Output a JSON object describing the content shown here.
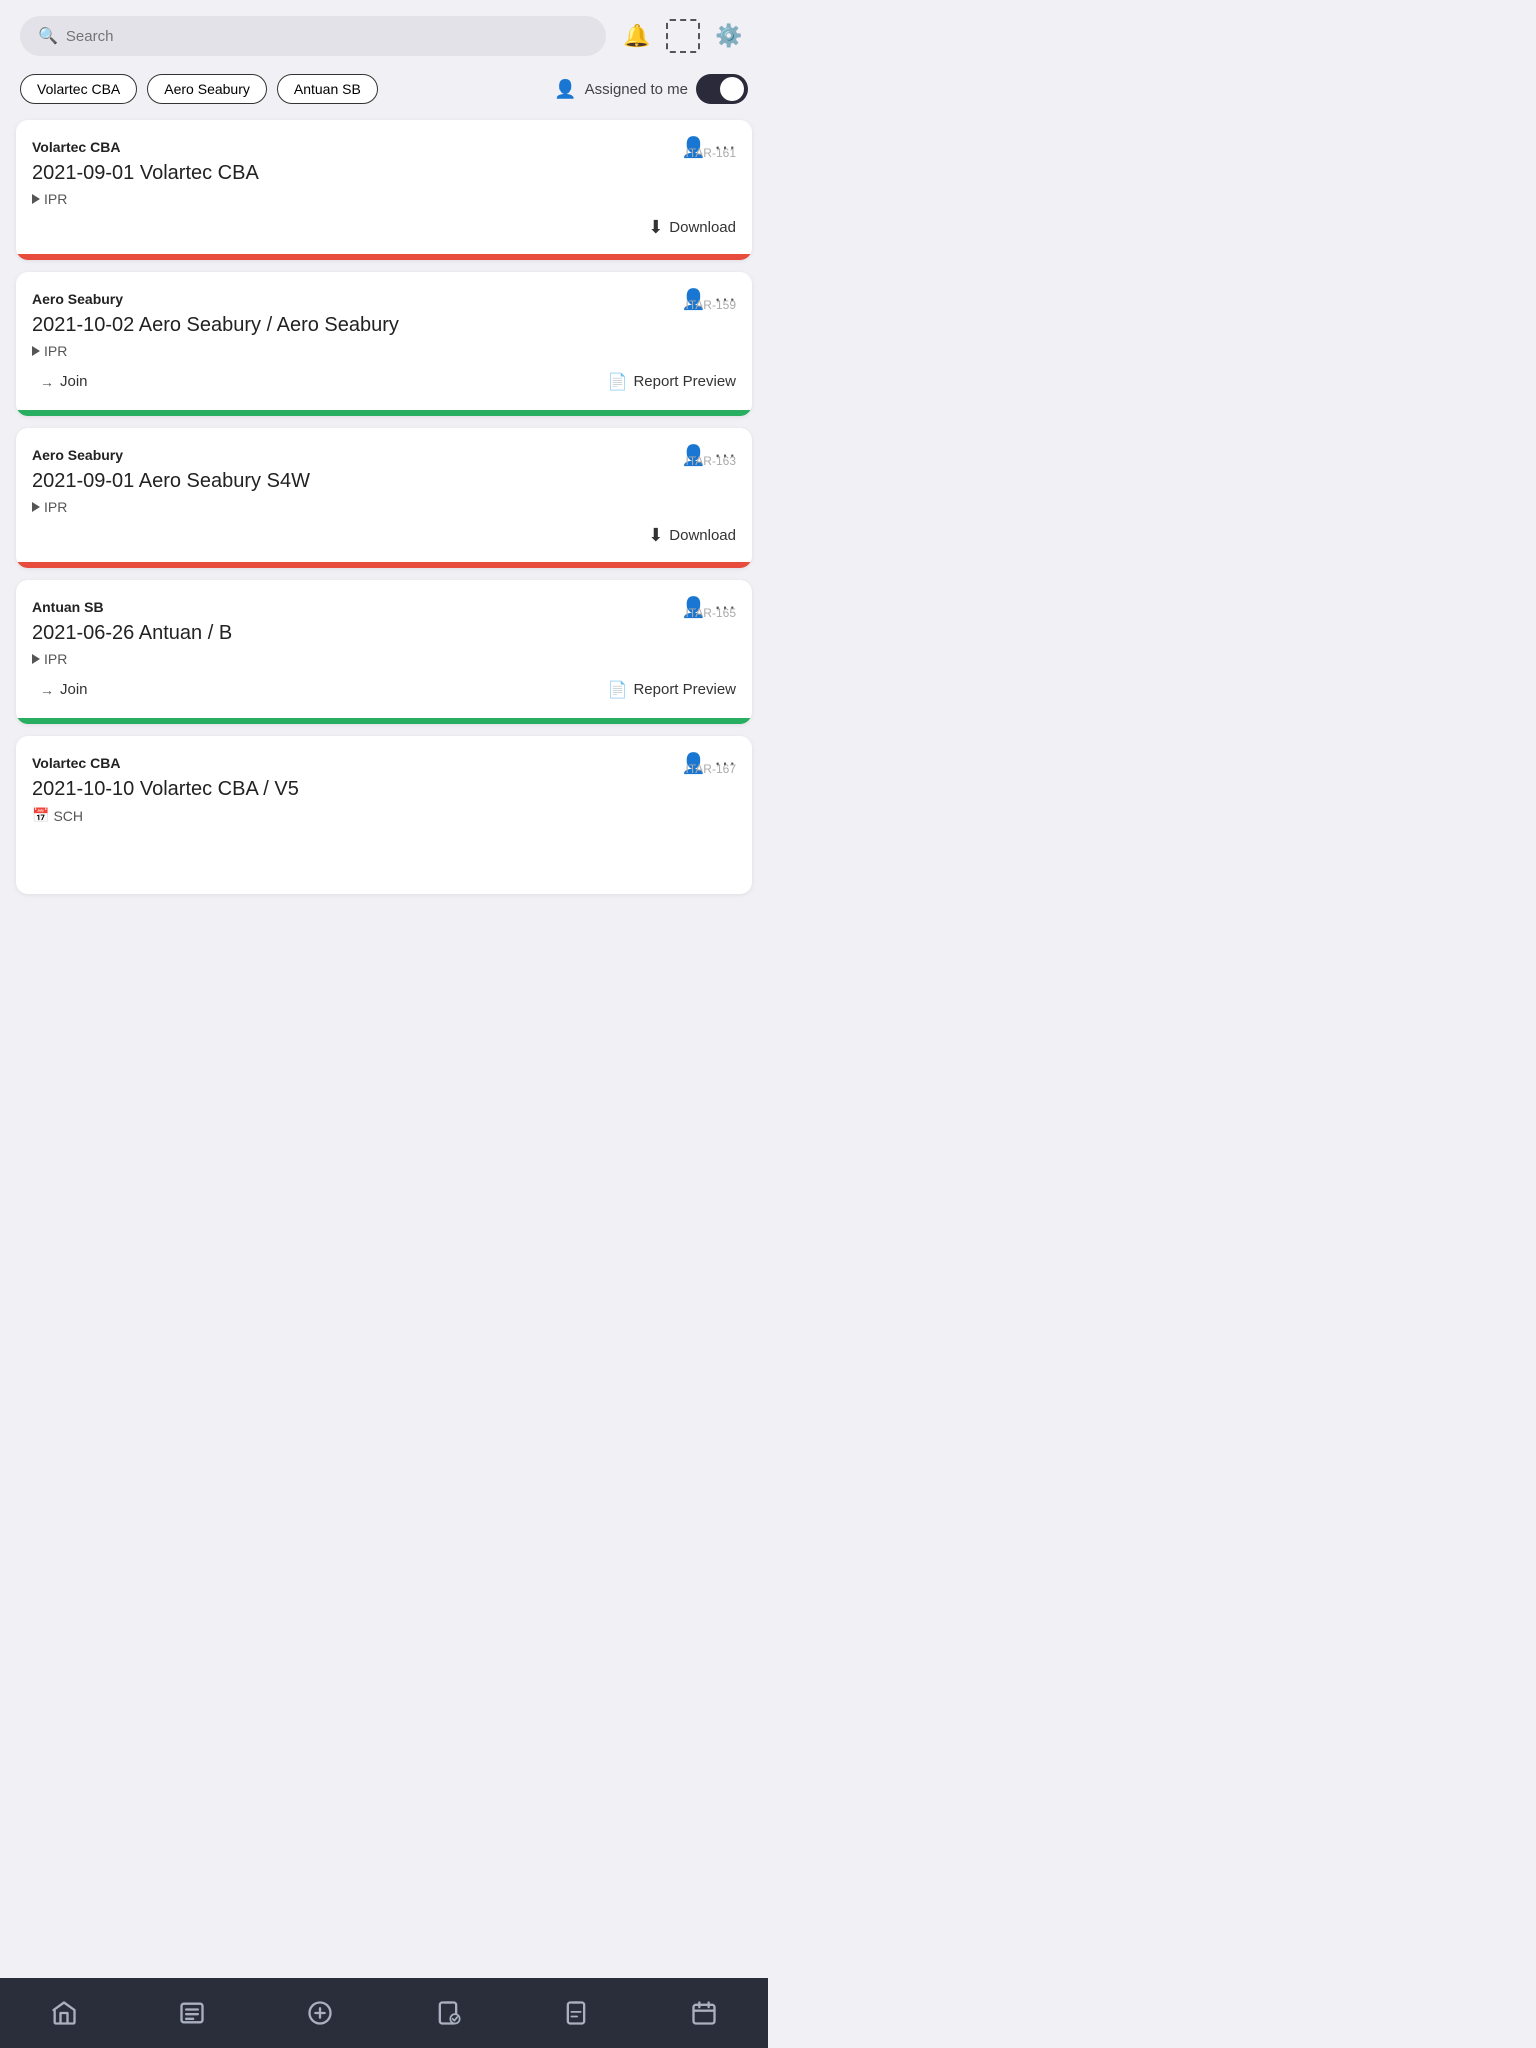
{
  "header": {
    "search_placeholder": "Search",
    "assigned_label": "Assigned to me"
  },
  "filters": [
    {
      "label": "Volartec CBA"
    },
    {
      "label": "Aero Seabury"
    },
    {
      "label": "Antuan SB"
    }
  ],
  "cards": [
    {
      "org": "Volartec CBA",
      "itar": "ITAR-161",
      "title": "2021-09-01 Volartec CBA",
      "tag_type": "triangle",
      "tag_label": "IPR",
      "actions": "download",
      "bar_color": "red"
    },
    {
      "org": "Aero Seabury",
      "itar": "ITAR-159",
      "title": "2021-10-02 Aero Seabury / Aero Seabury",
      "tag_type": "triangle",
      "tag_label": "IPR",
      "actions": "join_report",
      "join_label": "Join",
      "report_label": "Report Preview",
      "bar_color": "green"
    },
    {
      "org": "Aero Seabury",
      "itar": "ITAR-163",
      "title": "2021-09-01 Aero Seabury S4W",
      "tag_type": "triangle",
      "tag_label": "IPR",
      "actions": "download",
      "bar_color": "red"
    },
    {
      "org": "Antuan SB",
      "itar": "ITAR-165",
      "title": "2021-06-26 Antuan / B",
      "tag_type": "triangle",
      "tag_label": "IPR",
      "actions": "join_report",
      "join_label": "Join",
      "report_label": "Report Preview",
      "bar_color": "green"
    },
    {
      "org": "Volartec CBA",
      "itar": "ITAR-167",
      "title": "2021-10-10 Volartec CBA / V5",
      "tag_type": "calendar",
      "tag_label": "SCH",
      "actions": "download",
      "bar_color": "red"
    }
  ],
  "nav": {
    "items": [
      "home",
      "list",
      "plus-circle",
      "clipboard-check",
      "clipboard",
      "calendar"
    ]
  },
  "labels": {
    "download": "Download",
    "report_preview": "Report Preview",
    "join": "Join"
  }
}
